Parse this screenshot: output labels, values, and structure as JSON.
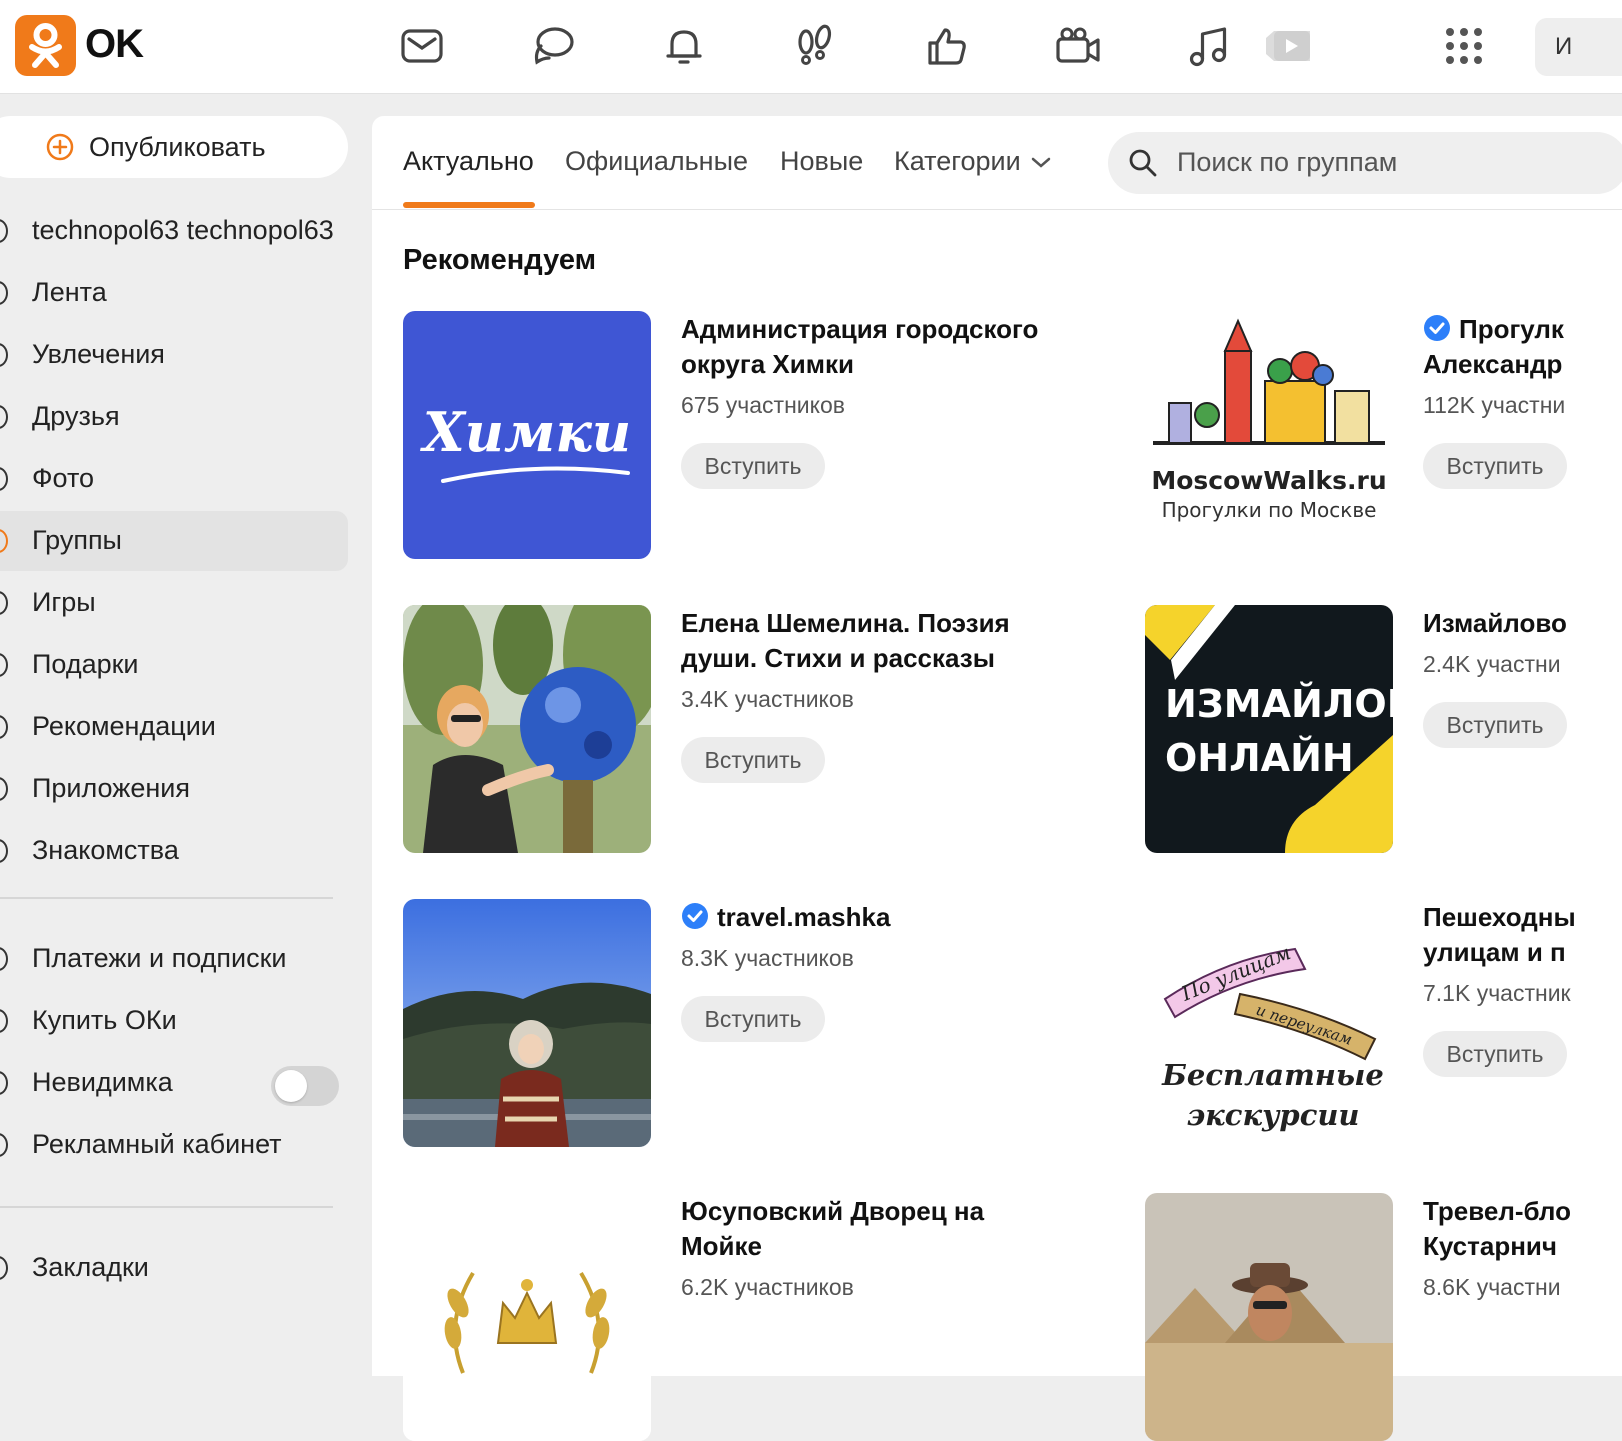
{
  "header": {
    "logo_text": "OK",
    "user_stub": "И",
    "icons": [
      "mail-icon",
      "discussions-icon",
      "notifications-icon",
      "guests-icon",
      "likes-icon",
      "video-icon",
      "music-icon",
      "videos-play-icon",
      "apps-grid-icon"
    ]
  },
  "sidebar": {
    "publish_label": "Опубликовать",
    "items": [
      {
        "label": "technopol63 technopol63"
      },
      {
        "label": "Лента"
      },
      {
        "label": "Увлечения"
      },
      {
        "label": "Друзья"
      },
      {
        "label": "Фото"
      },
      {
        "label": "Группы",
        "active": true
      },
      {
        "label": "Игры"
      },
      {
        "label": "Подарки"
      },
      {
        "label": "Рекомендации"
      },
      {
        "label": "Приложения"
      },
      {
        "label": "Знакомства"
      }
    ],
    "items2": [
      {
        "label": "Платежи и подписки"
      },
      {
        "label": "Купить ОКи"
      },
      {
        "label": "Невидимка"
      },
      {
        "label": "Рекламный кабинет"
      }
    ],
    "items3": [
      {
        "label": "Закладки"
      }
    ],
    "invisible_toggle_on": false
  },
  "tabs": [
    {
      "label": "Актуально",
      "active": true
    },
    {
      "label": "Официальные"
    },
    {
      "label": "Новые"
    },
    {
      "label": "Категории"
    }
  ],
  "search": {
    "placeholder": "Поиск по группам"
  },
  "section_title": "Рекомендуем",
  "join_label": "Вступить",
  "groups": [
    {
      "name_l1": "Администрация городского",
      "name_l2": "округа Химки",
      "members": "675 участников",
      "thumb_text": "Химки"
    },
    {
      "name_l1": "Прогулк",
      "name_l2": "Александр",
      "members": "112K участни",
      "verified": true,
      "thumb_text1": "MoscowWalks.ru",
      "thumb_text2": "Прогулки по Москве"
    },
    {
      "name_l1": "Елена Шемелина. Поэзия",
      "name_l2": "души. Стихи и рассказы",
      "members": "3.4K участников"
    },
    {
      "name_l1": "Измайлово",
      "members": "2.4K участни",
      "thumb_text1": "ИЗМАЙЛОВО",
      "thumb_text2": "ОНЛАЙН"
    },
    {
      "name_l1": "travel.mashka",
      "members": "8.3K участников",
      "verified": true
    },
    {
      "name_l1": "Пешеходны",
      "name_l2": "улицам и п",
      "members": "7.1K участник",
      "thumb_text1": "По улицам",
      "thumb_text2": "и переулкам",
      "thumb_text3": "Бесплатные",
      "thumb_text4": "экскурсии"
    },
    {
      "name_l1": "Юсуповский Дворец на",
      "name_l2": "Мойке",
      "members": "6.2K участников"
    },
    {
      "name_l1": "Тревел-бло",
      "name_l2": "Кустарнич",
      "members": "8.6K участни"
    }
  ],
  "colors": {
    "accent": "#f07a1a",
    "verified": "#2d7ff9",
    "khimki_bg": "#3f56d4",
    "izmailovo_bg": "#11181d",
    "izmailovo_yellow": "#f5d32b"
  }
}
